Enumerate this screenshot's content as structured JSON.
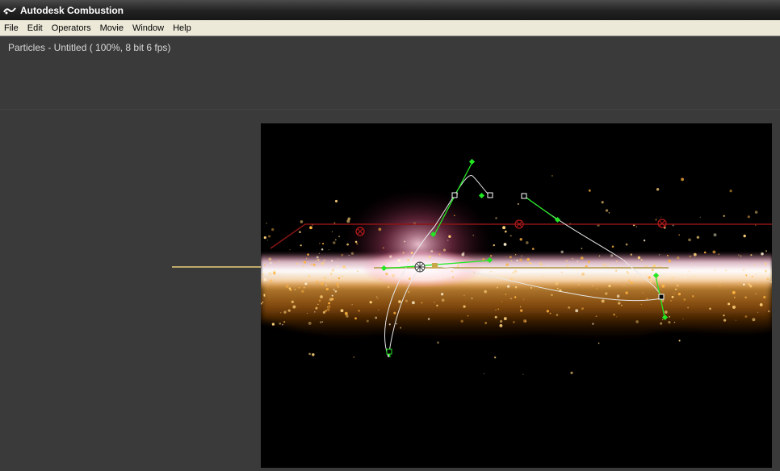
{
  "window": {
    "title": "Autodesk Combustion"
  },
  "menu": [
    "File",
    "Edit",
    "Operators",
    "Movie",
    "Window",
    "Help"
  ],
  "viewer": {
    "title": "Particles - Untitled ( 100%, 8 bit  6 fps)"
  },
  "icons": {
    "app": "combustion-logo-icon",
    "emitter": "particle-emitter-icon",
    "keyframe": "keyframe-marker-icon",
    "tangent": "tangent-handle-icon",
    "target": "target-marker-icon"
  },
  "colors": {
    "background": "#3a3a3a",
    "canvas": "#000000",
    "path": "#e8e8e8",
    "tangent": "#22e822",
    "guide": "#8a1515",
    "timeline": "#bfa96a",
    "particles": "#ffb340"
  }
}
